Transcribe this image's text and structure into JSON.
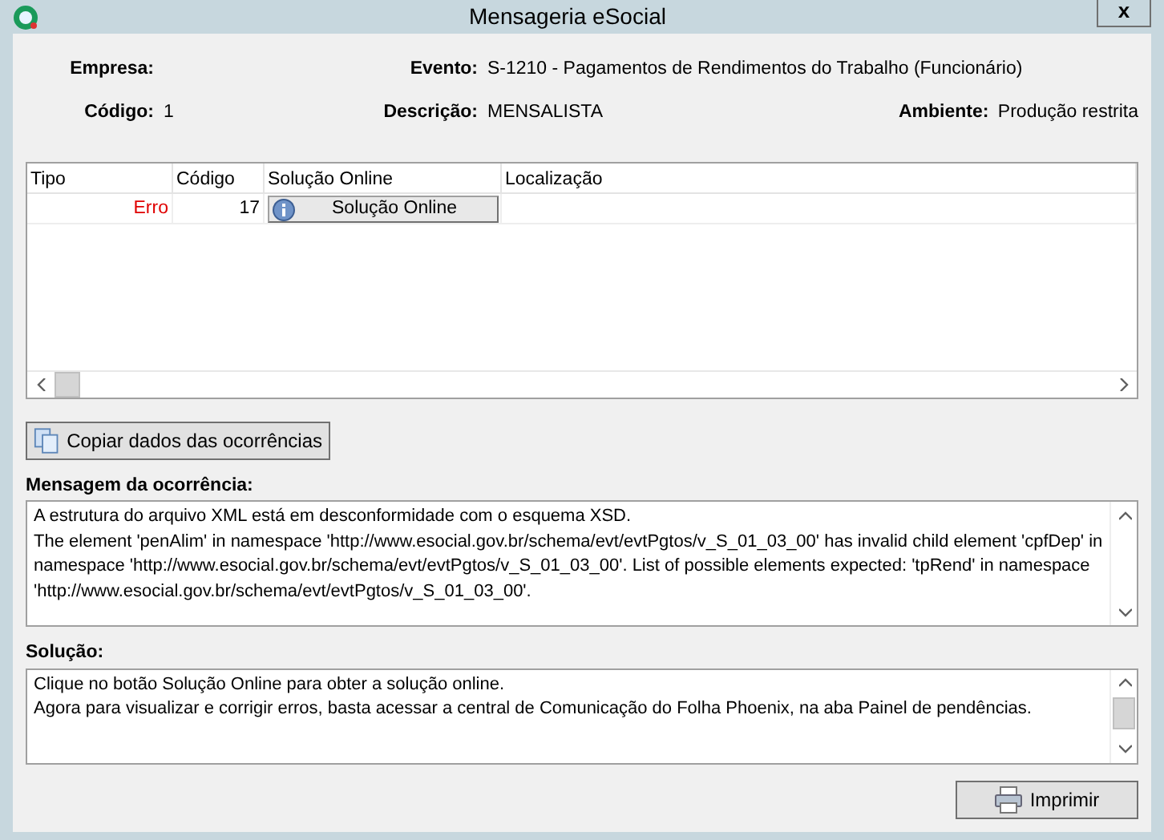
{
  "window": {
    "title": "Mensageria eSocial",
    "close": "x"
  },
  "header": {
    "empresa": {
      "label": "Empresa:"
    },
    "evento": {
      "label": "Evento:",
      "value": "S-1210 - Pagamentos de Rendimentos do Trabalho (Funcionário)"
    },
    "codigo": {
      "label": "Código:",
      "value": "1"
    },
    "descricao": {
      "label": "Descrição:",
      "value": "MENSALISTA"
    },
    "ambiente": {
      "label": "Ambiente:",
      "value": "Produção restrita"
    }
  },
  "table": {
    "columns": [
      "Tipo",
      "Código",
      "Solução Online",
      "Localização"
    ],
    "rows": [
      {
        "tipo": "Erro",
        "kind": "error",
        "codigo": "17",
        "button": "Solução Online"
      }
    ]
  },
  "copy_button": "Copiar dados das ocorrências",
  "message": {
    "label": "Mensagem da ocorrência:",
    "paragraphs": [
      "A estrutura do arquivo XML está em desconformidade com o esquema XSD.",
      "The element 'penAlim' in namespace 'http://www.esocial.gov.br/schema/evt/evtPgtos/v_S_01_03_00' has invalid child element 'cpfDep' in namespace 'http://www.esocial.gov.br/schema/evt/evtPgtos/v_S_01_03_00'. List of possible elements expected: 'tpRend' in namespace 'http://www.esocial.gov.br/schema/evt/evtPgtos/v_S_01_03_00'."
    ]
  },
  "solution": {
    "label": "Solução:",
    "paragraphs": [
      "Clique no botão Solução Online para obter a solução online.",
      "Agora para visualizar e corrigir erros, basta acessar a central de Comunicação do Folha Phoenix, na aba Painel de pendências."
    ]
  },
  "print_button": "Imprimir"
}
